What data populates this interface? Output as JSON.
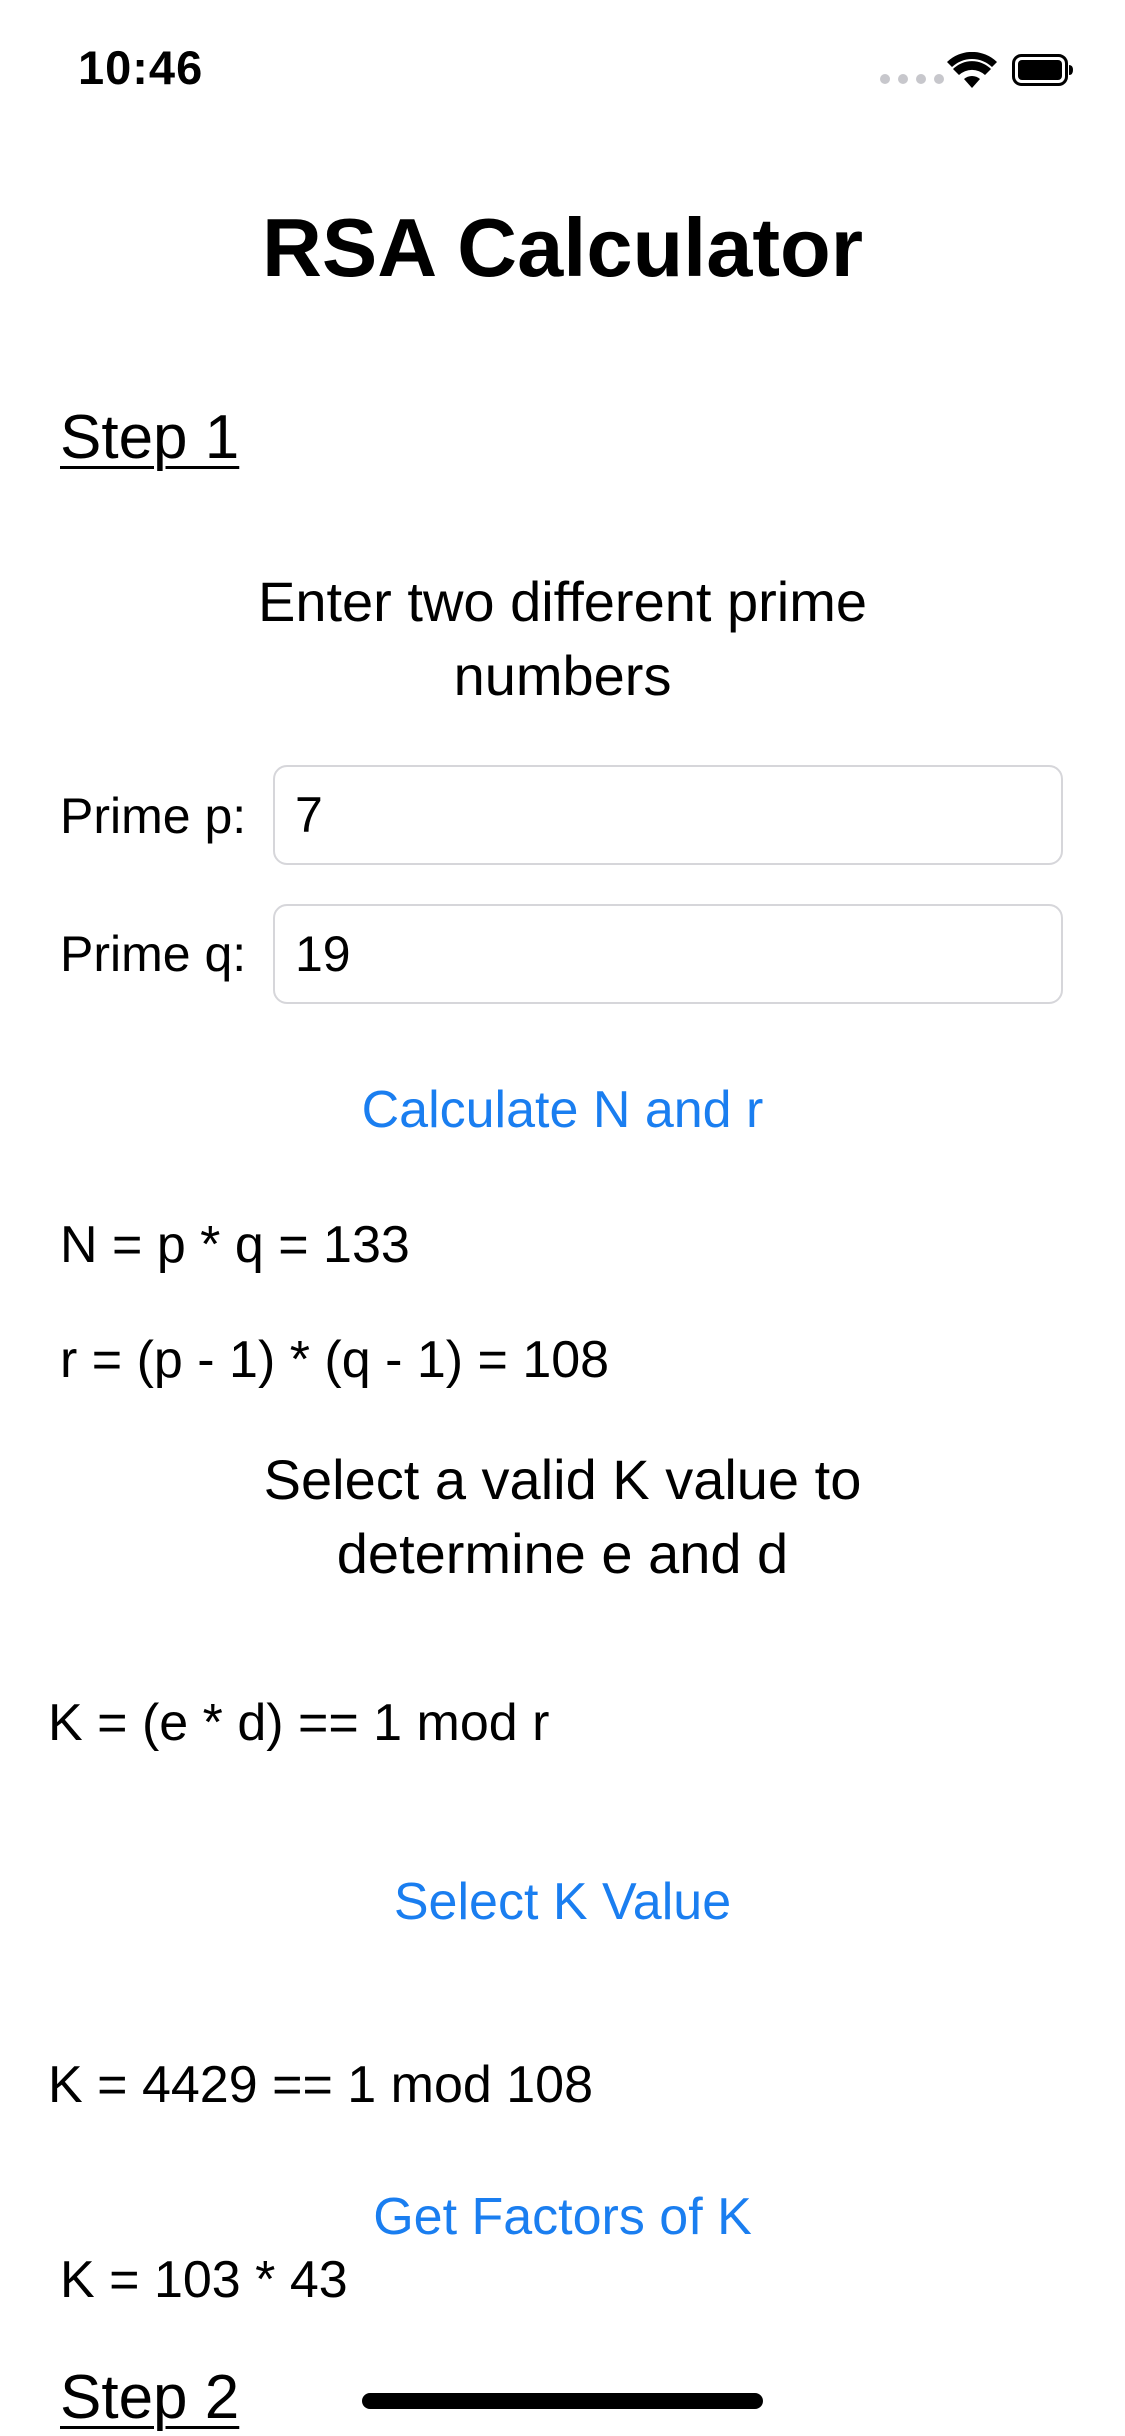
{
  "status_bar": {
    "time": "10:46"
  },
  "app": {
    "title": "RSA Calculator"
  },
  "step1": {
    "heading": "Step 1",
    "instruction": "Enter two different prime numbers",
    "prime_p_label": "Prime p:",
    "prime_p_value": "7",
    "prime_q_label": "Prime q:",
    "prime_q_value": "19",
    "calculate_button": "Calculate N and r",
    "n_result": "N = p * q = 133",
    "r_result": "r = (p - 1) * (q - 1) = 108",
    "select_instruction": "Select a valid K value to determine e and d",
    "k_formula": "K = (e * d) == 1 mod r",
    "select_k_button": "Select K Value",
    "k_result": "K = 4429 == 1 mod 108",
    "factors_button": "Get Factors of K",
    "factors_result": "K = 103 * 43"
  },
  "step2": {
    "heading": "Step 2"
  },
  "icons": {
    "signal": "cellular-signal-icon",
    "wifi": "wifi-icon",
    "battery": "battery-icon"
  },
  "colors": {
    "accent": "#1a7ef0",
    "field_border": "#d6d6da",
    "signal_dots": "#c7c7cc"
  }
}
